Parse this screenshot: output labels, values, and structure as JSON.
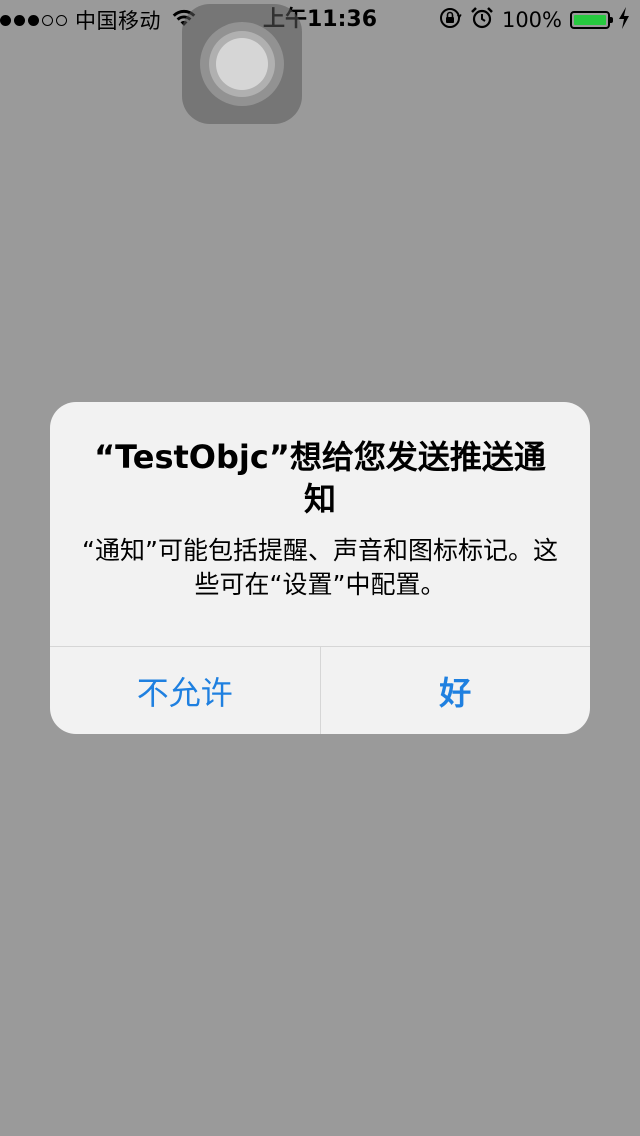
{
  "status_bar": {
    "carrier": "中国移动",
    "time": "上午11:36",
    "battery_text": "100%",
    "signal_bars_filled": 3,
    "signal_bars_total": 5,
    "battery_level": 1.0,
    "battery_color": "#27c93f"
  },
  "alert": {
    "title": "“TestObjc”想给您发送推送通知",
    "message": "“通知”可能包括提醒、声音和图标标记。这些可在“设置”中配置。",
    "deny_label": "不允许",
    "allow_label": "好",
    "accent_color": "#1f80e0"
  },
  "icons": {
    "signal": "signal-dots-icon",
    "wifi": "wifi-icon",
    "rotation_lock": "rotation-lock-icon",
    "alarm": "alarm-icon",
    "battery": "battery-icon",
    "charging": "charging-bolt-icon",
    "assistive_touch": "assistive-touch-icon"
  }
}
